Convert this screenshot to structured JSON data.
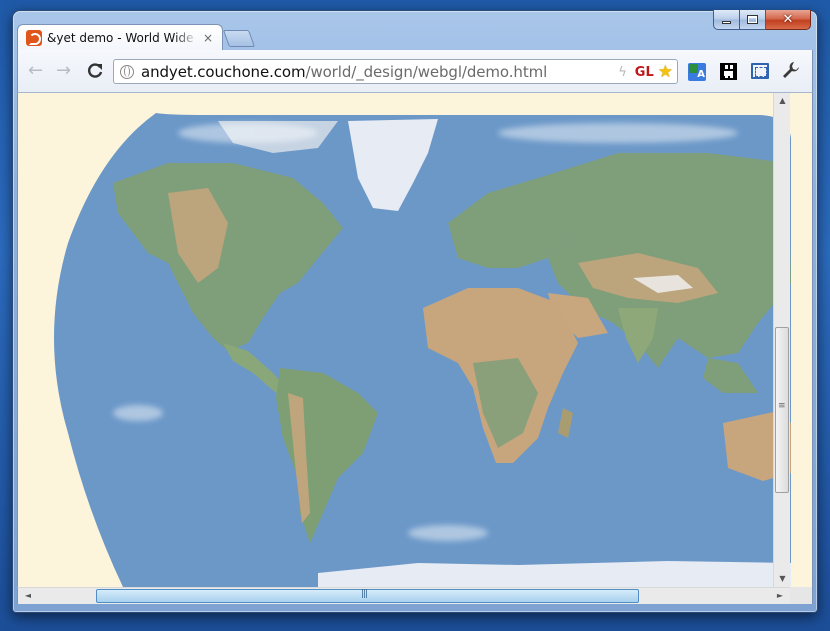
{
  "window": {
    "caption_minimize": "minimize",
    "caption_maximize": "maximize",
    "caption_close": "✕"
  },
  "tab": {
    "title": "&yet demo - World Wide W",
    "close_glyph": "×"
  },
  "toolbar": {
    "back_glyph": "←",
    "forward_glyph": "→",
    "reload_glyph": "C",
    "url_host": "andyet.couchone.com",
    "url_path": "/world/_design/webgl/demo.html",
    "gl_badge": "GL",
    "star_glyph": "★",
    "translate_glyph": "A",
    "wrench_glyph": "🔧"
  },
  "icons": [
    "back-arrow-icon",
    "forward-arrow-icon",
    "reload-icon",
    "globe-icon",
    "bolt-icon",
    "gl-extension-icon",
    "bookmark-star-icon",
    "translate-icon",
    "qr-code-icon",
    "screen-capture-icon",
    "wrench-icon",
    "favicon"
  ],
  "colors": {
    "page_background": "#fcf5db",
    "ocean": "#6c98c8",
    "land_green": "#7f9f7a",
    "land_tan": "#c7a57d",
    "ice": "#e7ebf3",
    "gl_badge": "#c0171b",
    "star": "#f4c10f"
  },
  "scrollbars": {
    "vertical_up": "▲",
    "vertical_down": "▼",
    "horizontal_left": "◄",
    "horizontal_right": "►"
  }
}
